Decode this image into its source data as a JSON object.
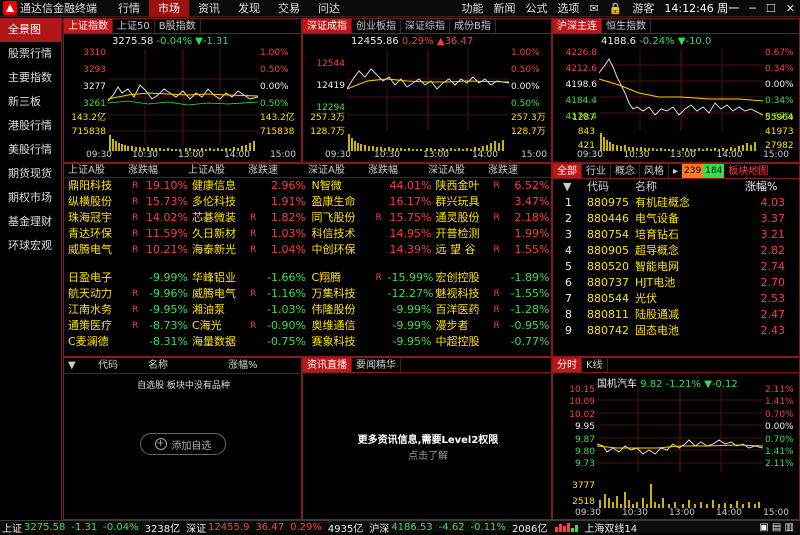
{
  "app": {
    "title": "通达信金融终端",
    "menu": [
      "行情",
      "市场",
      "资讯",
      "发现",
      "交易",
      "问达"
    ],
    "active_menu": "市场",
    "right_menu": [
      "功能",
      "新闻",
      "公式",
      "选项"
    ],
    "user": "游客",
    "clock": "14:12:46 周一"
  },
  "sidebar": [
    "全景图",
    "股票行情",
    "主要指数",
    "新三板",
    "港股行情",
    "美股行情",
    "期货现货",
    "期权市场",
    "基金理财",
    "环球宏观"
  ],
  "panel1": {
    "tabs": [
      "上证指数",
      "上证50",
      "B股指数"
    ],
    "info_val": "3275.58",
    "info_pct": "-0.04%",
    "info_chg": "▼-1.31",
    "y_left": [
      "3310",
      "3293",
      "3277",
      "3261"
    ],
    "y_right": [
      "1.00%",
      "0.50%",
      "0.00%",
      "0.50%"
    ],
    "vol_left": [
      "143.2亿",
      "715838"
    ],
    "vol_right": [
      "143.2亿",
      "715838"
    ],
    "x": [
      "09:30",
      "10:30",
      "13:00",
      "14:00",
      "15:00"
    ]
  },
  "panel2": {
    "tabs": [
      "深证成指",
      "创业板指",
      "深证综指",
      "成份B指"
    ],
    "info_val": "12455.86",
    "info_pct": "0.29%",
    "info_chg": "▲36.47",
    "y_left": [
      "12544",
      "12419",
      "12294"
    ],
    "y_right": [
      "1.00%",
      "0.50%",
      "0.00%",
      "0.50%"
    ],
    "vol_left": [
      "257.3万",
      "128.7万"
    ],
    "vol_right": [
      "257.3万",
      "128.7万"
    ],
    "x": [
      "09:30",
      "10:30",
      "13:00",
      "14:00",
      "15:00"
    ]
  },
  "panel3": {
    "tabs": [
      "沪深主连",
      "恒生指数"
    ],
    "info_val": "4188.6",
    "info_pct": "-0.24%",
    "info_chg": "▼-10.0",
    "y_left": [
      "4226.8",
      "4212.6",
      "4198.6",
      "4184.4",
      "4170.4"
    ],
    "y_right": [
      "0.67%",
      "0.34%",
      "0.00%",
      "0.34%",
      "0.67%"
    ],
    "vol_left": [
      "1287",
      "843",
      "421"
    ],
    "vol_right": [
      "55964",
      "41973",
      "27982"
    ],
    "x": [
      "09:30",
      "10:30",
      "13:00",
      "14:00",
      "15:00"
    ]
  },
  "stocks": {
    "headers": [
      "上证A股",
      "涨跌幅",
      "上证A股",
      "涨跌速",
      "深证A股",
      "涨跌幅",
      "深证A股",
      "涨跌速"
    ],
    "gain": [
      [
        {
          "n": "鼎阳科技",
          "t": "R",
          "p": "19.10%"
        },
        {
          "n": "健康信息",
          "t": "",
          "p": "2.96%"
        },
        {
          "n": "N智微",
          "t": "",
          "p": "44.01%"
        },
        {
          "n": "陕西金叶",
          "t": "R",
          "p": "6.52%"
        }
      ],
      [
        {
          "n": "纵横股份",
          "t": "R",
          "p": "15.73%"
        },
        {
          "n": "多伦科技",
          "t": "",
          "p": "1.91%"
        },
        {
          "n": "盈康生命",
          "t": "",
          "p": "16.17%"
        },
        {
          "n": "群兴玩具",
          "t": "",
          "p": "3.47%"
        }
      ],
      [
        {
          "n": "珠海冠宇",
          "t": "R",
          "p": "14.02%"
        },
        {
          "n": "芯碁微装",
          "t": "R",
          "p": "1.82%"
        },
        {
          "n": "同飞股份",
          "t": "R",
          "p": "15.75%"
        },
        {
          "n": "通灵股份",
          "t": "R",
          "p": "2.18%"
        }
      ],
      [
        {
          "n": "青达环保",
          "t": "R",
          "p": "11.59%"
        },
        {
          "n": "久日新材",
          "t": "R",
          "p": "1.03%"
        },
        {
          "n": "科信技术",
          "t": "",
          "p": "14.95%"
        },
        {
          "n": "开普检测",
          "t": "",
          "p": "1.99%"
        }
      ],
      [
        {
          "n": "威腾电气",
          "t": "R",
          "p": "10.21%"
        },
        {
          "n": "海泰新光",
          "t": "R",
          "p": "1.04%"
        },
        {
          "n": "中创环保",
          "t": "",
          "p": "14.39%"
        },
        {
          "n": "远 望 谷",
          "t": "R",
          "p": "1.55%"
        }
      ]
    ],
    "loss": [
      [
        {
          "n": "日盈电子",
          "t": "",
          "p": "-9.99%"
        },
        {
          "n": "华峰铝业",
          "t": "",
          "p": "-1.66%"
        },
        {
          "n": "C翔腾",
          "t": "R",
          "p": "-15.99%"
        },
        {
          "n": "宏创控股",
          "t": "",
          "p": "-1.89%"
        }
      ],
      [
        {
          "n": "航天动力",
          "t": "R",
          "p": "-9.96%"
        },
        {
          "n": "威腾电气",
          "t": "R",
          "p": "-1.16%"
        },
        {
          "n": "万集科技",
          "t": "",
          "p": "-12.27%"
        },
        {
          "n": "魅视科技",
          "t": "R",
          "p": "-1.55%"
        }
      ],
      [
        {
          "n": "江南水务",
          "t": "R",
          "p": "-9.95%"
        },
        {
          "n": "湘油泵",
          "t": "",
          "p": "-1.03%"
        },
        {
          "n": "伟隆股份",
          "t": "",
          "p": "-9.99%"
        },
        {
          "n": "百洋医药",
          "t": "R",
          "p": "-1.28%"
        }
      ],
      [
        {
          "n": "通策医疗",
          "t": "R",
          "p": "-8.73%"
        },
        {
          "n": "C海光",
          "t": "R",
          "p": "-0.90%"
        },
        {
          "n": "奥维通信",
          "t": "",
          "p": "-9.99%"
        },
        {
          "n": "漫步者",
          "t": "R",
          "p": "-0.95%"
        }
      ],
      [
        {
          "n": "C麦澜德",
          "t": "",
          "p": "-8.31%"
        },
        {
          "n": "海量数据",
          "t": "",
          "p": "-0.75%"
        },
        {
          "n": "赛象科技",
          "t": "",
          "p": "-9.95%"
        },
        {
          "n": "中超控股",
          "t": "",
          "p": "-0.77%"
        }
      ]
    ]
  },
  "sector": {
    "tabs": [
      "全部",
      "行业",
      "概念",
      "风格"
    ],
    "badge_a": "239",
    "badge_b": "184",
    "map_label": "板块地图",
    "cols": [
      "代码",
      "名称",
      "涨幅%"
    ],
    "rows": [
      {
        "i": "1",
        "c": "880975",
        "n": "有机硅概念",
        "p": "4.03"
      },
      {
        "i": "2",
        "c": "880446",
        "n": "电气设备",
        "p": "3.37"
      },
      {
        "i": "3",
        "c": "880754",
        "n": "培育钻石",
        "p": "3.21"
      },
      {
        "i": "4",
        "c": "880905",
        "n": "超导概念",
        "p": "2.82"
      },
      {
        "i": "5",
        "c": "880520",
        "n": "智能电网",
        "p": "2.74"
      },
      {
        "i": "6",
        "c": "880737",
        "n": "HJT电池",
        "p": "2.70"
      },
      {
        "i": "7",
        "c": "880544",
        "n": "光伏",
        "p": "2.53"
      },
      {
        "i": "8",
        "c": "880811",
        "n": "陆股通减",
        "p": "2.47"
      },
      {
        "i": "9",
        "c": "880742",
        "n": "固态电池",
        "p": "2.43"
      }
    ]
  },
  "watch": {
    "cols": [
      "代码",
      "名称",
      "涨幅%"
    ],
    "empty": "自选股 板块中没有品种",
    "add_label": "添加自选"
  },
  "news": {
    "tabs": [
      "资讯直播",
      "要闻精华"
    ],
    "title": "更多资讯信息,需要Level2权限",
    "link": "点击了解"
  },
  "mini": {
    "tabs": [
      "分时",
      "K线"
    ],
    "name": "国机汽车",
    "price": "9.82",
    "pct": "-1.21%",
    "chg": "▼-0.12",
    "y_left": [
      "10.15",
      "10.09",
      "10.02",
      "9.95",
      "9.87",
      "9.80",
      "9.73"
    ],
    "y_right": [
      "2.11%",
      "1.41%",
      "0.70%",
      "0.00%",
      "0.70%",
      "1.41%",
      "2.11%"
    ],
    "vol": [
      "3777",
      "2518"
    ],
    "x": [
      "09:30",
      "10:30",
      "13:00",
      "14:00",
      "15:00"
    ]
  },
  "status": {
    "sh_label": "上证",
    "sh_val": "3275.58",
    "sh_chg": "-1.31",
    "sh_pct": "-0.04%",
    "sh_amt": "3238亿",
    "sz_label": "深证",
    "sz_val": "12455.9",
    "sz_chg": "36.47",
    "sz_pct": "0.29%",
    "sz_amt": "4935亿",
    "hs_label": "沪深",
    "hs_val": "4186.53",
    "hs_chg": "-4.62",
    "hs_pct": "-0.11%",
    "hs_amt": "2086亿",
    "server": "上海双线14"
  },
  "colors": {
    "up": "#ff3b3b",
    "down": "#2fe24a",
    "frame": "#8a1a1a",
    "accent": "#c01515"
  }
}
